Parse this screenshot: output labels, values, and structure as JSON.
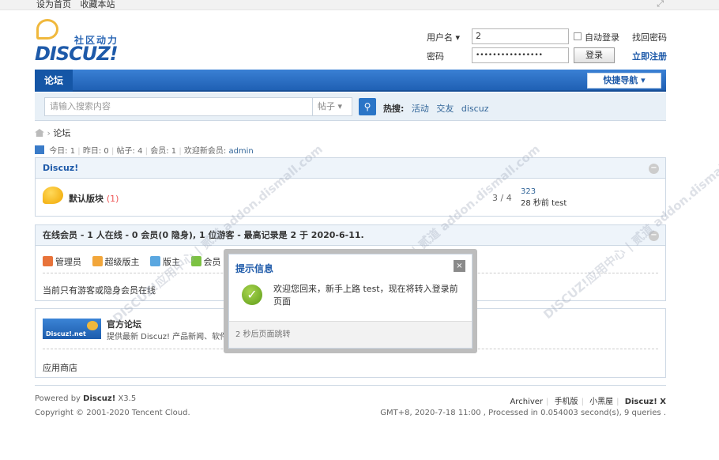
{
  "topbar": {
    "set_home": "设为首页",
    "bookmark": "收藏本站"
  },
  "logo": {
    "tagline": "社区动力",
    "name": "DISCUZ!"
  },
  "login": {
    "username_label": "用户名",
    "username_value": "2",
    "password_label": "密码",
    "password_value": "••••••••••••••••",
    "auto_login": "自动登录",
    "login_button": "登录",
    "find_password": "找回密码",
    "register": "立即注册"
  },
  "nav": {
    "tab": "论坛",
    "quick_nav": "快捷导航"
  },
  "search": {
    "placeholder": "请输入搜索内容",
    "type": "帖子",
    "hot_label": "热搜:",
    "hot_items": [
      "活动",
      "交友",
      "discuz"
    ]
  },
  "breadcrumb": {
    "current": "论坛"
  },
  "stats": {
    "today": "今日: 1",
    "yesterday": "昨日: 0",
    "posts": "帖子: 4",
    "members": "会员: 1",
    "welcome": "欢迎新会员:",
    "newest": "admin"
  },
  "forum_box": {
    "title": "Discuz!",
    "forum_name": "默认版块",
    "forum_new": "(1)",
    "counts": "3 / 4",
    "last_post_id": "323",
    "last_post_info": "28 秒前 test"
  },
  "online": {
    "title": "在线会员 - 1 人在线 - 0 会员(0 隐身), 1 位游客 - 最高记录是 2 于 2020-6-11.",
    "legend": [
      "管理员",
      "超级版主",
      "版主",
      "会员"
    ],
    "note": "当前只有游客或隐身会员在线"
  },
  "links": {
    "badge": "Discuz!.net",
    "title": "官方论坛",
    "desc": "提供最新 Discuz! 产品新闻、软件下",
    "store": "应用商店"
  },
  "footer": {
    "powered": "Powered by",
    "product": "Discuz!",
    "version": "X3.5",
    "copyright": "Copyright © 2001-2020 Tencent Cloud.",
    "right_links": [
      "Archiver",
      "手机版",
      "小黑屋"
    ],
    "right_brand": "Discuz! X",
    "server": "GMT+8, 2020-7-18 11:00 , Processed in 0.054003 second(s), 9 queries ."
  },
  "dialog": {
    "title": "提示信息",
    "close": "×",
    "message": "欢迎您回来，新手上路 test，现在将转入登录前页面",
    "footer": "2 秒后页面跳转"
  },
  "colors": {
    "accent": "#1e5aa9",
    "nav": "#2a6cc0",
    "success": "#6aa61e"
  },
  "watermark": "DISCUZ!应用中心 | 贰道 addon.dismall.com"
}
